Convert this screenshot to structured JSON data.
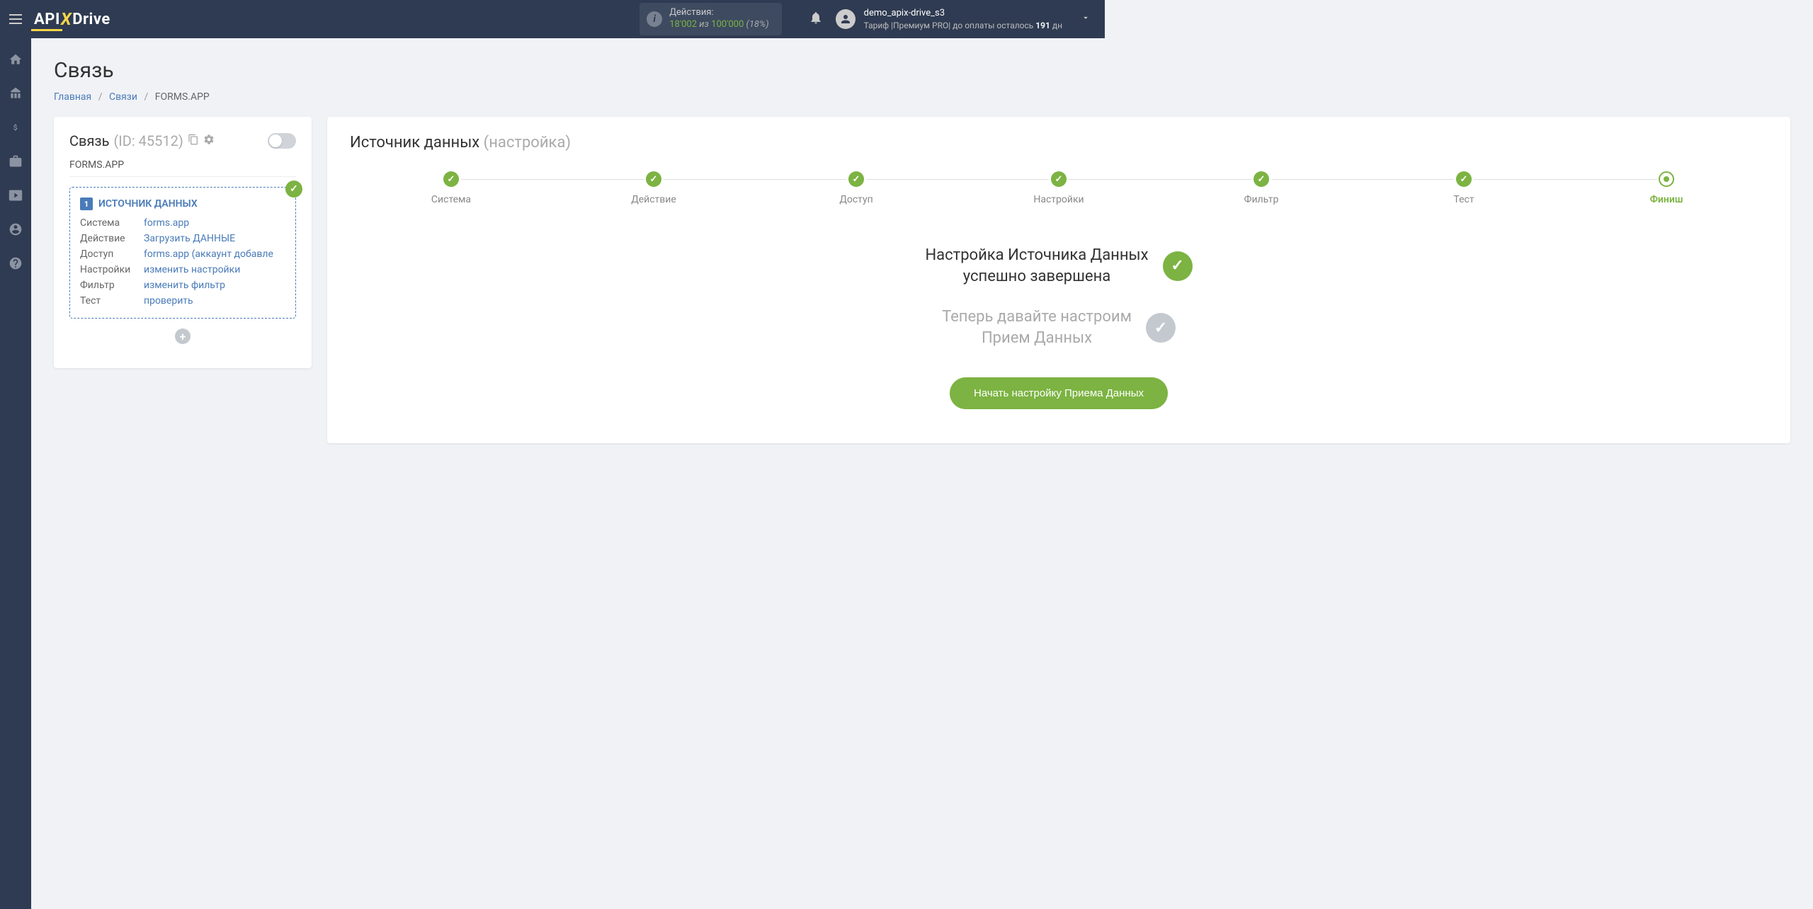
{
  "header": {
    "logo": {
      "a": "API",
      "x": "X",
      "d": "Drive"
    },
    "actions": {
      "label": "Действия:",
      "used": "18'002",
      "of": "из",
      "total": "100'000",
      "pct": "(18%)"
    },
    "user": {
      "name": "demo_apix-drive_s3",
      "tariff_pre": "Тариф |Премиум PRO| до оплаты осталось ",
      "days": "191",
      "tariff_post": " дн"
    }
  },
  "page": {
    "title": "Связь",
    "breadcrumb": {
      "home": "Главная",
      "links": "Связи",
      "current": "FORMS.APP"
    }
  },
  "left": {
    "title": "Связь",
    "id_label": "(ID: 45512)",
    "app": "FORMS.APP",
    "source_title": "ИСТОЧНИК ДАННЫХ",
    "source_number": "1",
    "rows": [
      {
        "label": "Система",
        "value": "forms.app"
      },
      {
        "label": "Действие",
        "value": "Загрузить ДАННЫЕ"
      },
      {
        "label": "Доступ",
        "value": "forms.app (аккаунт добавле"
      },
      {
        "label": "Настройки",
        "value": "изменить настройки"
      },
      {
        "label": "Фильтр",
        "value": "изменить фильтр"
      },
      {
        "label": "Тест",
        "value": "проверить"
      }
    ]
  },
  "right": {
    "title_main": "Источник данных",
    "title_sub": "(настройка)",
    "steps": [
      {
        "label": "Система",
        "state": "done"
      },
      {
        "label": "Действие",
        "state": "done"
      },
      {
        "label": "Доступ",
        "state": "done"
      },
      {
        "label": "Настройки",
        "state": "done"
      },
      {
        "label": "Фильтр",
        "state": "done"
      },
      {
        "label": "Тест",
        "state": "done"
      },
      {
        "label": "Финиш",
        "state": "current"
      }
    ],
    "done_line1": "Настройка Источника Данных",
    "done_line2": "успешно завершена",
    "next_line1": "Теперь давайте настроим",
    "next_line2": "Прием Данных",
    "button": "Начать настройку Приема Данных"
  }
}
